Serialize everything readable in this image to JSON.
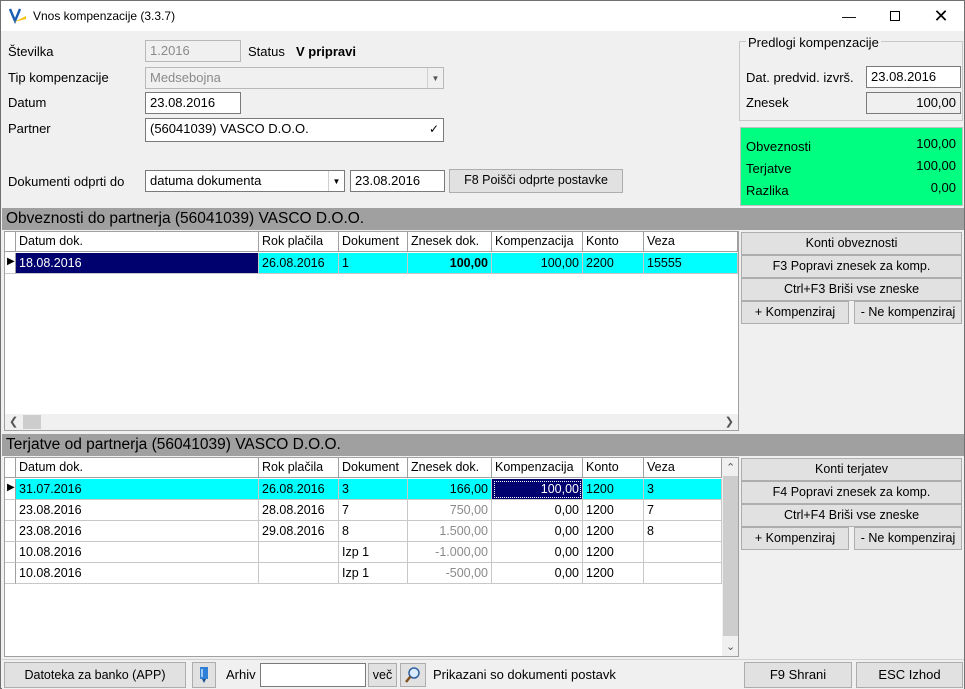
{
  "window": {
    "title": "Vnos kompenzacije  (3.3.7)"
  },
  "form": {
    "stevilka_label": "Številka",
    "stevilka_value": "1.2016",
    "status_label": "Status",
    "status_value": "V pripravi",
    "tip_label": "Tip kompenzacije",
    "tip_value": "Medsebojna",
    "datum_label": "Datum",
    "datum_value": "23.08.2016",
    "partner_label": "Partner",
    "partner_value": "(56041039) VASCO D.O.O.",
    "dokumenti_label": "Dokumenti odprti do",
    "dokumenti_select": "datuma dokumenta",
    "dokumenti_date": "23.08.2016",
    "find_button": "F8 Poišči odprte postavke"
  },
  "predlogi": {
    "title": "Predlogi kompenzacije",
    "dat_label": "Dat. predvid. izvrš.",
    "dat_value": "23.08.2016",
    "znesek_label": "Znesek",
    "znesek_value": "100,00"
  },
  "summary": {
    "obveznosti_label": "Obveznosti",
    "obveznosti_value": "100,00",
    "terjatve_label": "Terjatve",
    "terjatve_value": "100,00",
    "razlika_label": "Razlika",
    "razlika_value": "0,00",
    "color": "#00ff80"
  },
  "obveznosti": {
    "title": "Obveznosti do partnerja (56041039) VASCO D.O.O.",
    "columns": [
      "Datum dok.",
      "Rok plačila",
      "Dokument",
      "Znesek dok.",
      "Kompenzacija",
      "Konto",
      "Veza"
    ],
    "rows": [
      {
        "datum": "18.08.2016",
        "rok": "26.08.2016",
        "dokument": "1",
        "znesek": "100,00",
        "komp": "100,00",
        "konto": "2200",
        "veza": "15555"
      }
    ],
    "buttons": {
      "konti": "Konti obveznosti",
      "popravi": "F3 Popravi znesek za komp.",
      "brisi": "Ctrl+F3 Briši vse zneske",
      "kompenziraj": "+ Kompenziraj",
      "ne_kompenziraj": "- Ne kompenziraj"
    }
  },
  "terjatve": {
    "title": "Terjatve od partnerja (56041039) VASCO D.O.O.",
    "columns": [
      "Datum dok.",
      "Rok plačila",
      "Dokument",
      "Znesek dok.",
      "Kompenzacija",
      "Konto",
      "Veza"
    ],
    "rows": [
      {
        "datum": "31.07.2016",
        "rok": "26.08.2016",
        "dokument": "3",
        "znesek": "166,00",
        "komp": "100,00",
        "konto": "1200",
        "veza": "3"
      },
      {
        "datum": "23.08.2016",
        "rok": "28.08.2016",
        "dokument": "7",
        "znesek": "750,00",
        "komp": "0,00",
        "konto": "1200",
        "veza": "7"
      },
      {
        "datum": "23.08.2016",
        "rok": "29.08.2016",
        "dokument": "8",
        "znesek": "1.500,00",
        "komp": "0,00",
        "konto": "1200",
        "veza": "8"
      },
      {
        "datum": "10.08.2016",
        "rok": "",
        "dokument": "Izp 1",
        "znesek": "-1.000,00",
        "komp": "0,00",
        "konto": "1200",
        "veza": ""
      },
      {
        "datum": "10.08.2016",
        "rok": "",
        "dokument": "Izp 1",
        "znesek": "-500,00",
        "komp": "0,00",
        "konto": "1200",
        "veza": ""
      }
    ],
    "buttons": {
      "konti": "Konti terjatev",
      "popravi": "F4 Popravi znesek za komp.",
      "brisi": "Ctrl+F4 Briši vse zneske",
      "kompenziraj": "+ Kompenziraj",
      "ne_kompenziraj": "- Ne kompenziraj"
    }
  },
  "footer": {
    "datoteka_button": "Datoteka za banko (APP)",
    "arhiv_label": "Arhiv",
    "arhiv_value": "",
    "vec_button": "več",
    "status_text": "Prikazani so dokumenti postavk",
    "save_button": "F9 Shrani",
    "exit_button": "ESC Izhod"
  }
}
